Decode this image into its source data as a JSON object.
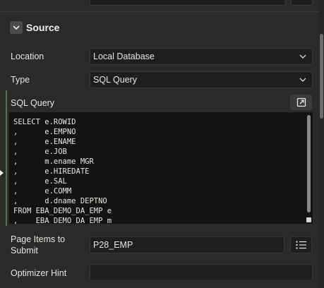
{
  "section": {
    "title": "Source",
    "toggle_icon": "chevron-down-icon"
  },
  "location": {
    "label": "Location",
    "value": "Local Database"
  },
  "type": {
    "label": "Type",
    "value": "SQL Query"
  },
  "sql_query": {
    "label": "SQL Query",
    "expand_icon": "open-in-editor-icon",
    "lines": [
      "SELECT e.ROWID",
      ",      e.EMPNO",
      ",      e.ENAME",
      ",      e.JOB",
      ",      m.ename MGR",
      ",      e.HIREDATE",
      ",      e.SAL",
      ",      e.COMM",
      ",      d.dname DEPTNO",
      "FROM EBA_DEMO_DA_EMP e",
      ",    EBA_DEMO_DA_EMP m"
    ]
  },
  "page_items": {
    "label_line1": "Page Items to",
    "label_line2": "Submit",
    "value": "P28_EMP",
    "picker_icon": "list-picker-icon"
  },
  "optimizer_hint": {
    "label": "Optimizer Hint",
    "value": ""
  },
  "colors": {
    "background": "#2b2a29",
    "field_background": "#1f1e1d",
    "editor_background": "#141312",
    "accent_bar": "#3a7f5a"
  }
}
